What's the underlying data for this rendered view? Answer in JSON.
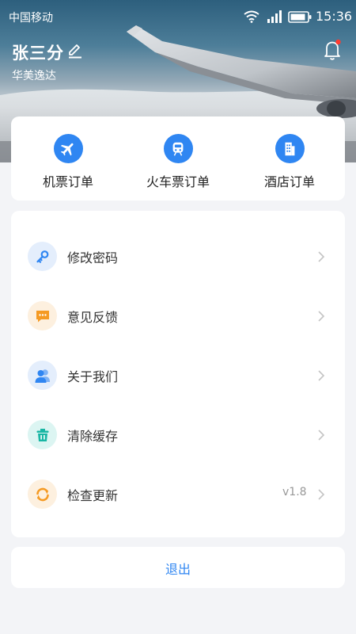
{
  "status_bar": {
    "carrier": "中国移动",
    "time": "15:36",
    "icons": [
      "wifi-icon",
      "signal-icon",
      "battery-icon"
    ]
  },
  "profile": {
    "name": "张三分",
    "company": "华美逸达",
    "edit_icon": "pencil-icon",
    "notification_icon": "bell-icon",
    "has_unread": true
  },
  "orders": [
    {
      "label": "机票订单",
      "icon": "airplane-icon"
    },
    {
      "label": "火车票订单",
      "icon": "train-icon"
    },
    {
      "label": "酒店订单",
      "icon": "hotel-icon"
    }
  ],
  "menu": [
    {
      "label": "修改密码",
      "icon": "key-icon",
      "value": ""
    },
    {
      "label": "意见反馈",
      "icon": "chat-bubble-icon",
      "value": ""
    },
    {
      "label": "关于我们",
      "icon": "users-icon",
      "value": ""
    },
    {
      "label": "清除缓存",
      "icon": "trash-icon",
      "value": ""
    },
    {
      "label": "检查更新",
      "icon": "refresh-icon",
      "value": "v1.8"
    }
  ],
  "logout": {
    "label": "退出"
  },
  "colors": {
    "accent": "#2f86f2",
    "page_background": "#f3f4f7",
    "notification_dot": "#ff3b30"
  }
}
